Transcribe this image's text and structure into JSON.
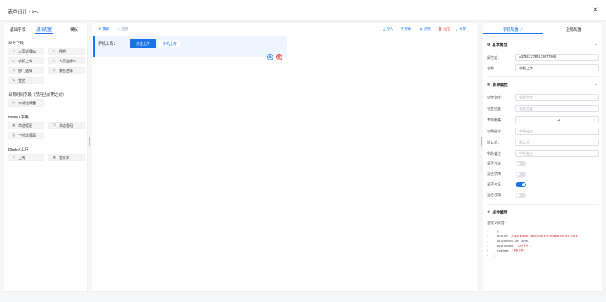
{
  "window": {
    "title": "表单设计 - test",
    "close": "✕"
  },
  "left": {
    "tabs": [
      "基础字段",
      "通用配置",
      "模板"
    ],
    "groups": [
      {
        "title": "业务字段",
        "items": [
          {
            "icon": "user-icon",
            "glyph": "⇔",
            "label": "人员选择v1"
          },
          {
            "icon": "link-icon",
            "glyph": "⇔",
            "label": "经组"
          },
          {
            "icon": "mobile-icon",
            "glyph": "▭",
            "label": "手机上传"
          },
          {
            "icon": "user-icon",
            "glyph": "⇔",
            "label": "人员选择v2"
          },
          {
            "icon": "org-icon",
            "glyph": "♙",
            "label": "部门选择"
          },
          {
            "icon": "role-icon",
            "glyph": "♙",
            "label": "角色选择"
          },
          {
            "icon": "sign-icon",
            "glyph": "✎",
            "label": "签名"
          }
        ]
      },
      {
        "title": "日期时间字段（禁用当前期之前）",
        "items": [
          {
            "icon": "clock-icon",
            "glyph": "◷",
            "label": "日期选择器"
          }
        ]
      },
      {
        "title": "BladeX字典",
        "items": [
          {
            "icon": "radio-icon",
            "glyph": "◉",
            "label": "单选框组"
          },
          {
            "icon": "checkbox-icon",
            "glyph": "☐",
            "label": "多选框组"
          },
          {
            "icon": "select-icon",
            "glyph": "◎",
            "label": "下拉选择器"
          }
        ]
      },
      {
        "title": "BladeX上传",
        "items": [
          {
            "icon": "upload-icon",
            "glyph": "⇪",
            "label": "上传"
          },
          {
            "icon": "richtext-icon",
            "glyph": "▦",
            "label": "富文本"
          }
        ]
      }
    ]
  },
  "center": {
    "toolbar_left": [
      {
        "icon": "undo-icon",
        "glyph": "↺",
        "label": "撤销",
        "color": "#1a73e8"
      },
      {
        "icon": "redo-icon",
        "glyph": "↻",
        "label": "重做",
        "color": "#9aa8c0"
      }
    ],
    "toolbar_right": [
      {
        "icon": "import-icon",
        "glyph": "⤓",
        "label": "导入",
        "color": "#1a73e8"
      },
      {
        "icon": "export-icon",
        "glyph": "⤒",
        "label": "导出",
        "color": "#1a73e8"
      },
      {
        "icon": "preview-icon",
        "glyph": "◈",
        "label": "预览",
        "color": "#1a73e8"
      },
      {
        "icon": "clear-icon",
        "glyph": "🗑",
        "label": "清空",
        "color": "#e53935"
      },
      {
        "icon": "save-icon",
        "glyph": "⤓",
        "label": "保存",
        "color": "#1a73e8"
      }
    ],
    "field": {
      "label": "手机上传：",
      "button": "点击上传",
      "tag": "手机上传"
    }
  },
  "right": {
    "tabs": [
      "字段配置 ↗",
      "全局配置"
    ],
    "basic": {
      "title": "基本属性",
      "rows": [
        {
          "label": "属性值：",
          "value": "a175513784176674208"
        },
        {
          "label": "名称：",
          "value": "手机上传"
        }
      ]
    },
    "form": {
      "title": "表单属性",
      "rows": [
        {
          "label": "标签宽度：",
          "placeholder": "标签宽度"
        },
        {
          "label": "标签位置：",
          "placeholder": "标签位置"
        },
        {
          "label": "表单栅格：",
          "value": "12"
        },
        {
          "label": "标题提示：",
          "placeholder": "标题提示"
        },
        {
          "label": "默认值：",
          "placeholder": "默认值"
        },
        {
          "label": "字段备注：",
          "placeholder": "字段备注"
        }
      ],
      "switches": [
        {
          "label": "是否只读：",
          "on": false
        },
        {
          "label": "是否禁用：",
          "on": false
        },
        {
          "label": "是否可见：",
          "on": true
        },
        {
          "label": "是否必填：",
          "on": false
        }
      ]
    },
    "component": {
      "title": "组件属性",
      "sub": "自定义属性：",
      "code": [
        {
          "n": "1",
          "text": "{",
          "fold": "▾ "
        },
        {
          "n": "2",
          "key": "  action: ",
          "str": "'/api/blade-resource/oss/endpoint/put-file'"
        },
        {
          "n": "3",
          "key": "  uploadMaxSize: ",
          "plain": "4096,"
        },
        {
          "n": "4",
          "key": "  buttonName: ",
          "str": "'点击上传',"
        },
        {
          "n": "5",
          "key": "  tagName: ",
          "str": "'手机上传'"
        },
        {
          "n": "6",
          "text": "}"
        }
      ]
    }
  }
}
